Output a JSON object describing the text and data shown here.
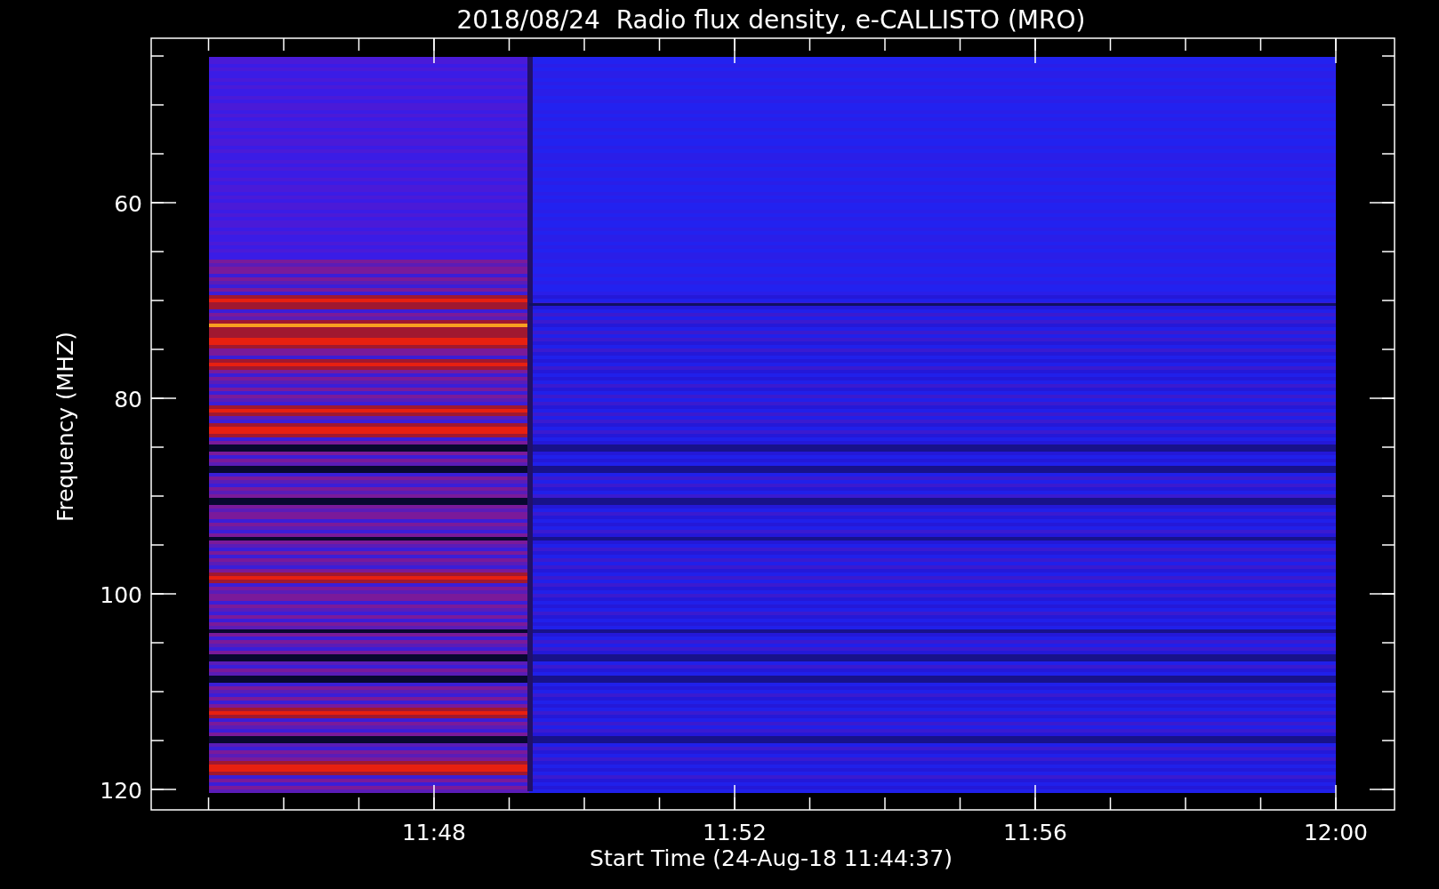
{
  "title": "2018/08/24  Radio flux density, e-CALLISTO (MRO)",
  "y_axis": {
    "label": "Frequency (MHZ)",
    "ticks": [
      "60",
      "80",
      "100",
      "120"
    ]
  },
  "x_axis": {
    "label": "Start Time (24-Aug-18 11:44:37)",
    "ticks": [
      "11:48",
      "11:52",
      "11:56",
      "12:00"
    ]
  }
}
